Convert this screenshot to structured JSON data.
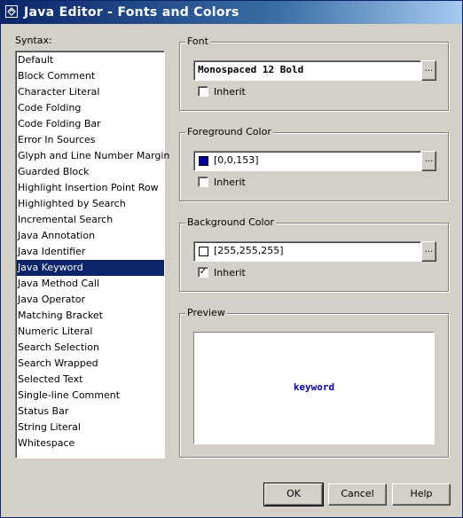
{
  "window": {
    "title": "Java Editor - Fonts and Colors"
  },
  "syntax": {
    "label": "Syntax:",
    "items": [
      "Default",
      "Block Comment",
      "Character Literal",
      "Code Folding",
      "Code Folding Bar",
      "Error In Sources",
      "Glyph and Line Number Margin",
      "Guarded Block",
      "Highlight Insertion Point Row",
      "Highlighted by Search",
      "Incremental Search",
      "Java Annotation",
      "Java Identifier",
      "Java Keyword",
      "Java Method Call",
      "Java Operator",
      "Matching Bracket",
      "Numeric Literal",
      "Search Selection",
      "Search Wrapped",
      "Selected Text",
      "Single-line Comment",
      "Status Bar",
      "String Literal",
      "Whitespace"
    ],
    "selected": "Java Keyword"
  },
  "font": {
    "title": "Font",
    "value": "Monospaced 12 Bold",
    "button": "...",
    "inherit_label": "Inherit",
    "inherit_checked": false
  },
  "foreground": {
    "title": "Foreground Color",
    "value": "[0,0,153]",
    "swatch_color": "#000099",
    "button": "...",
    "inherit_label": "Inherit",
    "inherit_checked": false
  },
  "background": {
    "title": "Background Color",
    "value": "[255,255,255]",
    "swatch_color": "#ffffff",
    "button": "...",
    "inherit_label": "Inherit",
    "inherit_checked": true
  },
  "preview": {
    "title": "Preview",
    "sample": "keyword",
    "sample_color": "#000099"
  },
  "buttons": {
    "ok": "OK",
    "cancel": "Cancel",
    "help": "Help"
  }
}
